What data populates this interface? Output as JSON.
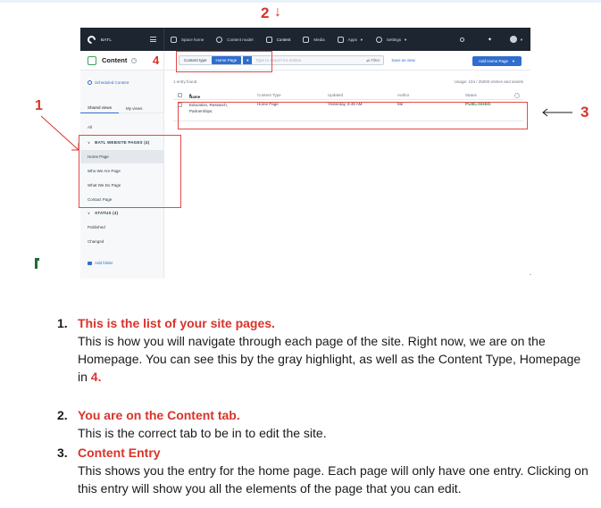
{
  "annotations": {
    "n1": "1",
    "n2": "2",
    "n3": "3",
    "n4": "4",
    "arrow_down": "↓"
  },
  "app": {
    "brand": "BATL",
    "nav": [
      {
        "label": "Space home"
      },
      {
        "label": "Content model"
      },
      {
        "label": "Content"
      },
      {
        "label": "Media"
      },
      {
        "label": "Apps"
      },
      {
        "label": "Settings"
      }
    ],
    "page_title": "Content",
    "content_type_label": "Content type",
    "content_type_value": "Home Page",
    "search_placeholder": "Type to search for entries",
    "filter_label": "Filter",
    "save_view_label": "Save as view",
    "add_button_label": "Add Home Page"
  },
  "sidebar": {
    "scheduled": "Scheduled Content",
    "tabs": [
      "Shared views",
      "My views"
    ],
    "all": "All",
    "group1": "BATL WEBSITE PAGES (4)",
    "pages": [
      "Home Page",
      "Who We Are Page",
      "What We Do Page",
      "Contact Page"
    ],
    "group2": "STATUS (4)",
    "statuses": [
      "Published",
      "Changed"
    ],
    "add_folder": "Add folder"
  },
  "table": {
    "entries_found": "1 entry found",
    "usage": "Usage: 104 / 25000 entries and assets",
    "columns": [
      "Name",
      "Content Type",
      "Updated",
      "Author",
      "Status"
    ],
    "rows": [
      {
        "name": "Education, Research, Partnerships.",
        "content_type": "Home Page",
        "updated": "Yesterday, 8:49 AM",
        "author": "Me",
        "status": "PUBLISHED"
      }
    ]
  },
  "instructions": [
    {
      "num": "1.",
      "heading": "This is the list of your site pages.",
      "body": "This is how you will navigate through each page of the site. Right now, we are on the Homepage. You can see this by the gray highlight, as well as the Content Type, Homepage in",
      "ref": "4."
    },
    {
      "num": "2.",
      "heading": "You are on the Content tab.",
      "body": "This is the correct tab to be in to edit the site."
    },
    {
      "num": "3.",
      "heading": "Content Entry",
      "body": "This shows you the entry for the home page. Each page will only have one entry. Clicking on this entry will show you all the elements of the page that you can edit."
    }
  ],
  "colors": {
    "annotation_red": "#d9332a",
    "nav_dark": "#1c2530",
    "accent_blue": "#2f6ecf",
    "published_green": "#1e8c4e"
  }
}
